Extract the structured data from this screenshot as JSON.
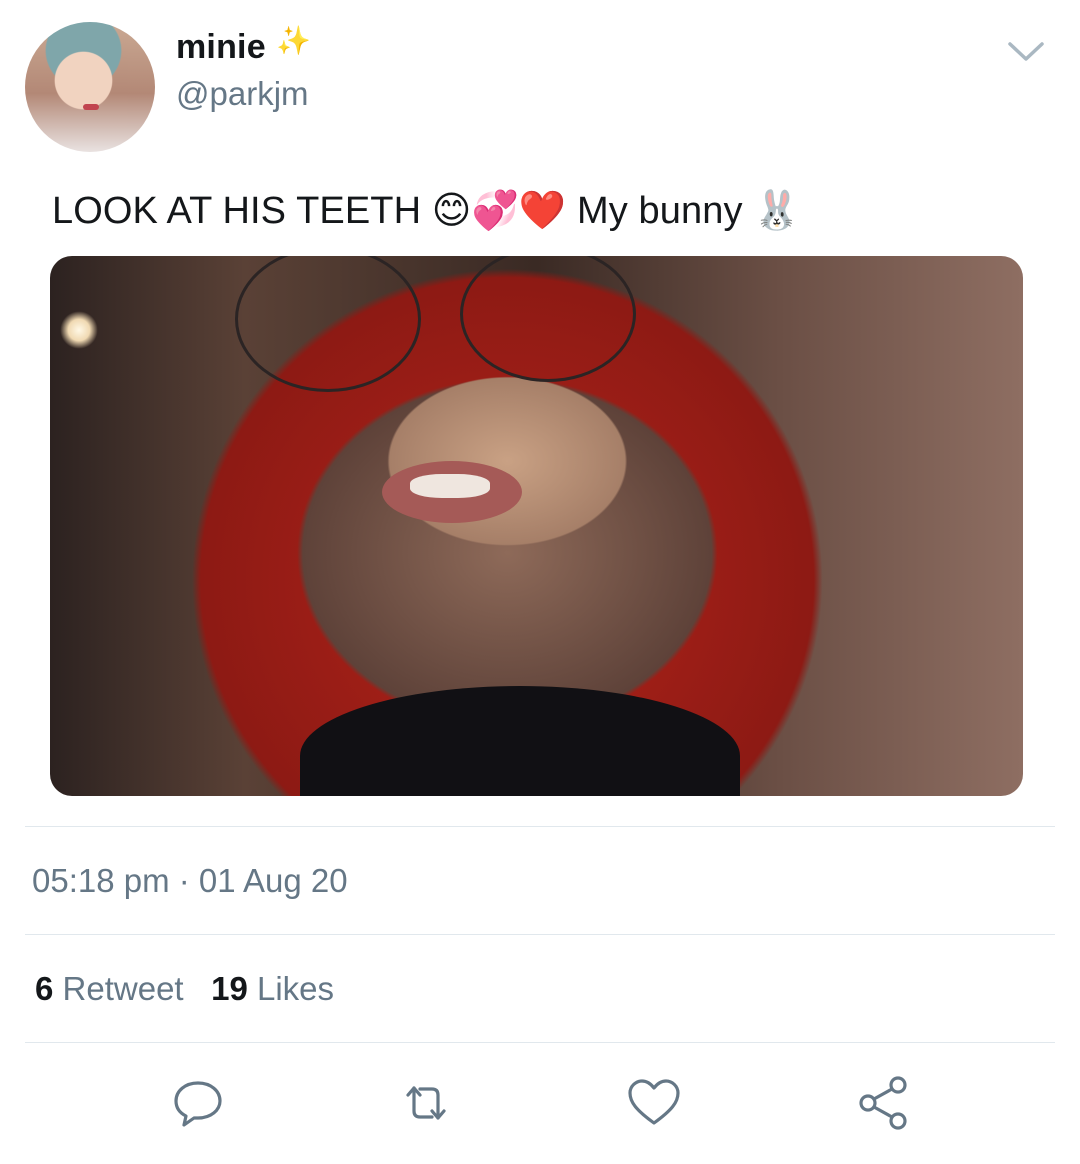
{
  "user": {
    "display_name": "minie",
    "badge_emoji": "✨",
    "handle": "@parkjm"
  },
  "tweet": {
    "text": "LOOK AT HIS TEETH 😊💞❤️ My bunny 🐰",
    "timestamp": "05:18 pm · 01 Aug 20"
  },
  "stats": {
    "retweet_count": "6",
    "retweet_label": "Retweet",
    "like_count": "19",
    "like_label": "Likes"
  },
  "actions": [
    {
      "icon": "reply-icon"
    },
    {
      "icon": "retweet-icon"
    },
    {
      "icon": "like-icon"
    },
    {
      "icon": "share-icon"
    }
  ],
  "colors": {
    "text_primary": "#14171a",
    "text_secondary": "#657786",
    "divider": "#e1e8ed",
    "icon": "#657786"
  }
}
